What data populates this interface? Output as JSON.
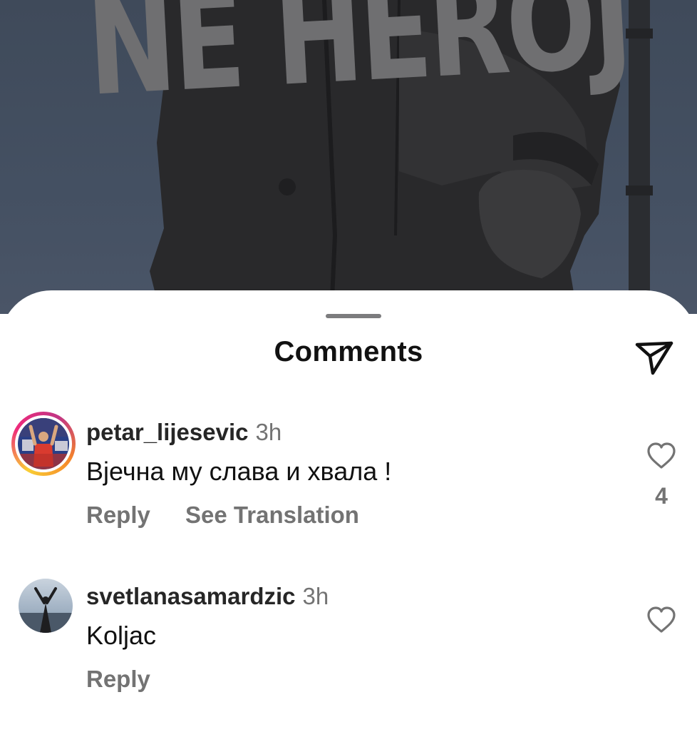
{
  "post": {
    "overlay_text": "NE HEROJ"
  },
  "sheet": {
    "title": "Comments"
  },
  "comments": [
    {
      "username": "petar_lijesevic",
      "time": "3h",
      "text": "Вјечна му слава и хвала !",
      "actions": [
        "Reply",
        "See Translation"
      ],
      "likes": "4",
      "story_ring": true
    },
    {
      "username": "svetlanasamardzic",
      "time": "3h",
      "text": "Koljac",
      "actions": [
        "Reply"
      ],
      "likes": "",
      "story_ring": false
    }
  ],
  "icons": {
    "share": "paper-plane-icon",
    "like": "heart-outline-icon"
  },
  "colors": {
    "ring_gradient": [
      "#f9ce34",
      "#ee2a7b",
      "#c13584",
      "#f58529"
    ],
    "secondary_text": "#737373"
  }
}
